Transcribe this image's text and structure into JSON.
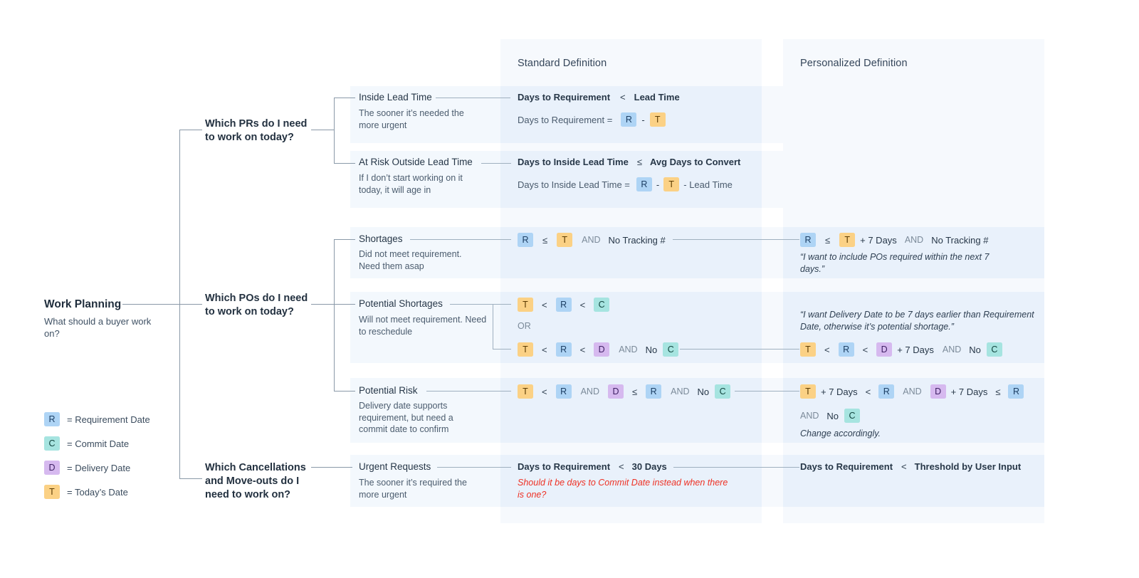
{
  "columns": {
    "standard_title": "Standard Definition",
    "personalized_title": "Personalized Definition"
  },
  "root": {
    "title": "Work Planning",
    "subtitle": "What should a buyer work on?"
  },
  "legend": [
    {
      "token": "R",
      "label": "= Requirement Date",
      "color": "#aed4f5"
    },
    {
      "token": "C",
      "label": "= Commit Date",
      "color": "#a6e4e0"
    },
    {
      "token": "D",
      "label": "= Delivery Date",
      "color": "#d6b9ef"
    },
    {
      "token": "T",
      "label": "= Today’s Date",
      "color": "#fbd185"
    }
  ],
  "questions": [
    {
      "id": "prs",
      "text": "Which PRs do I need to work on today?"
    },
    {
      "id": "pos",
      "text": "Which POs do I need to work on today?"
    },
    {
      "id": "cancel",
      "text": "Which Cancellations and Move-outs do I need to work on?"
    }
  ],
  "rows": [
    {
      "id": "inside-lead-time",
      "title": "Inside Lead Time",
      "subtitle": "The sooner it’s needed the more urgent",
      "standard": {
        "line1": {
          "a": "Days to Requirement",
          "op": "<",
          "b": "Lead Time"
        },
        "line2_prefix": "Days to Requirement =",
        "line2_tokens": [
          "R",
          "-",
          "T"
        ]
      },
      "personalized": {}
    },
    {
      "id": "at-risk-outside-lead-time",
      "title": "At Risk Outside Lead Time",
      "subtitle": "If I don’t start working on it today, it will age in",
      "standard": {
        "line1": {
          "a": "Days to Inside Lead Time",
          "op": "≤",
          "b": "Avg Days to Convert"
        },
        "line2_prefix": "Days to Inside Lead Time =",
        "line2_tokens": [
          "R",
          "-",
          "T",
          "- Lead Time"
        ]
      },
      "personalized": {}
    },
    {
      "id": "shortages",
      "title": "Shortages",
      "subtitle": "Did not meet requirement. Need them asap",
      "standard": {
        "expr": "R ≤ T AND No Tracking #"
      },
      "personalized": {
        "expr": "R ≤ T + 7 Days AND No Tracking #",
        "quote": "“I want to include POs required within the next 7 days.”"
      }
    },
    {
      "id": "potential-shortages",
      "title": "Potential Shortages",
      "subtitle": "Will not meet requirement. Need to reschedule",
      "standard": {
        "expr_a": "T < R < C",
        "connector": "OR",
        "expr_b": "T < R < D AND No C"
      },
      "personalized": {
        "quote": "“I want Delivery Date to be 7 days earlier than Requirement Date, otherwise it’s potential shortage.”",
        "expr": "T < R < D + 7 Days AND No C"
      }
    },
    {
      "id": "potential-risk",
      "title": "Potential Risk",
      "subtitle": "Delivery date supports requirement, but need a commit date to confirm",
      "standard": {
        "expr": "T < R AND D ≤ R AND No C"
      },
      "personalized": {
        "expr_line1": "T + 7 Days < R AND D + 7 Days ≤ R",
        "expr_line2": "AND No C",
        "quote": "Change accordingly."
      }
    },
    {
      "id": "urgent-requests",
      "title": "Urgent Requests",
      "subtitle": "The sooner it’s required the more urgent",
      "standard": {
        "line1": {
          "a": "Days to Requirement",
          "op": "<",
          "b": "30 Days"
        },
        "note": "Should it be days to Commit Date instead when there is one?"
      },
      "personalized": {
        "line1": {
          "a": "Days to Requirement",
          "op": "<",
          "b": "Threshold by User Input"
        }
      }
    }
  ],
  "labels": {
    "and": "AND",
    "or": "OR",
    "no": "No",
    "tracking": "No Tracking #",
    "plus7": "+ 7 Days",
    "minus": "-",
    "lt": "<",
    "le": "≤",
    "lead_time_minus": "- Lead Time"
  }
}
